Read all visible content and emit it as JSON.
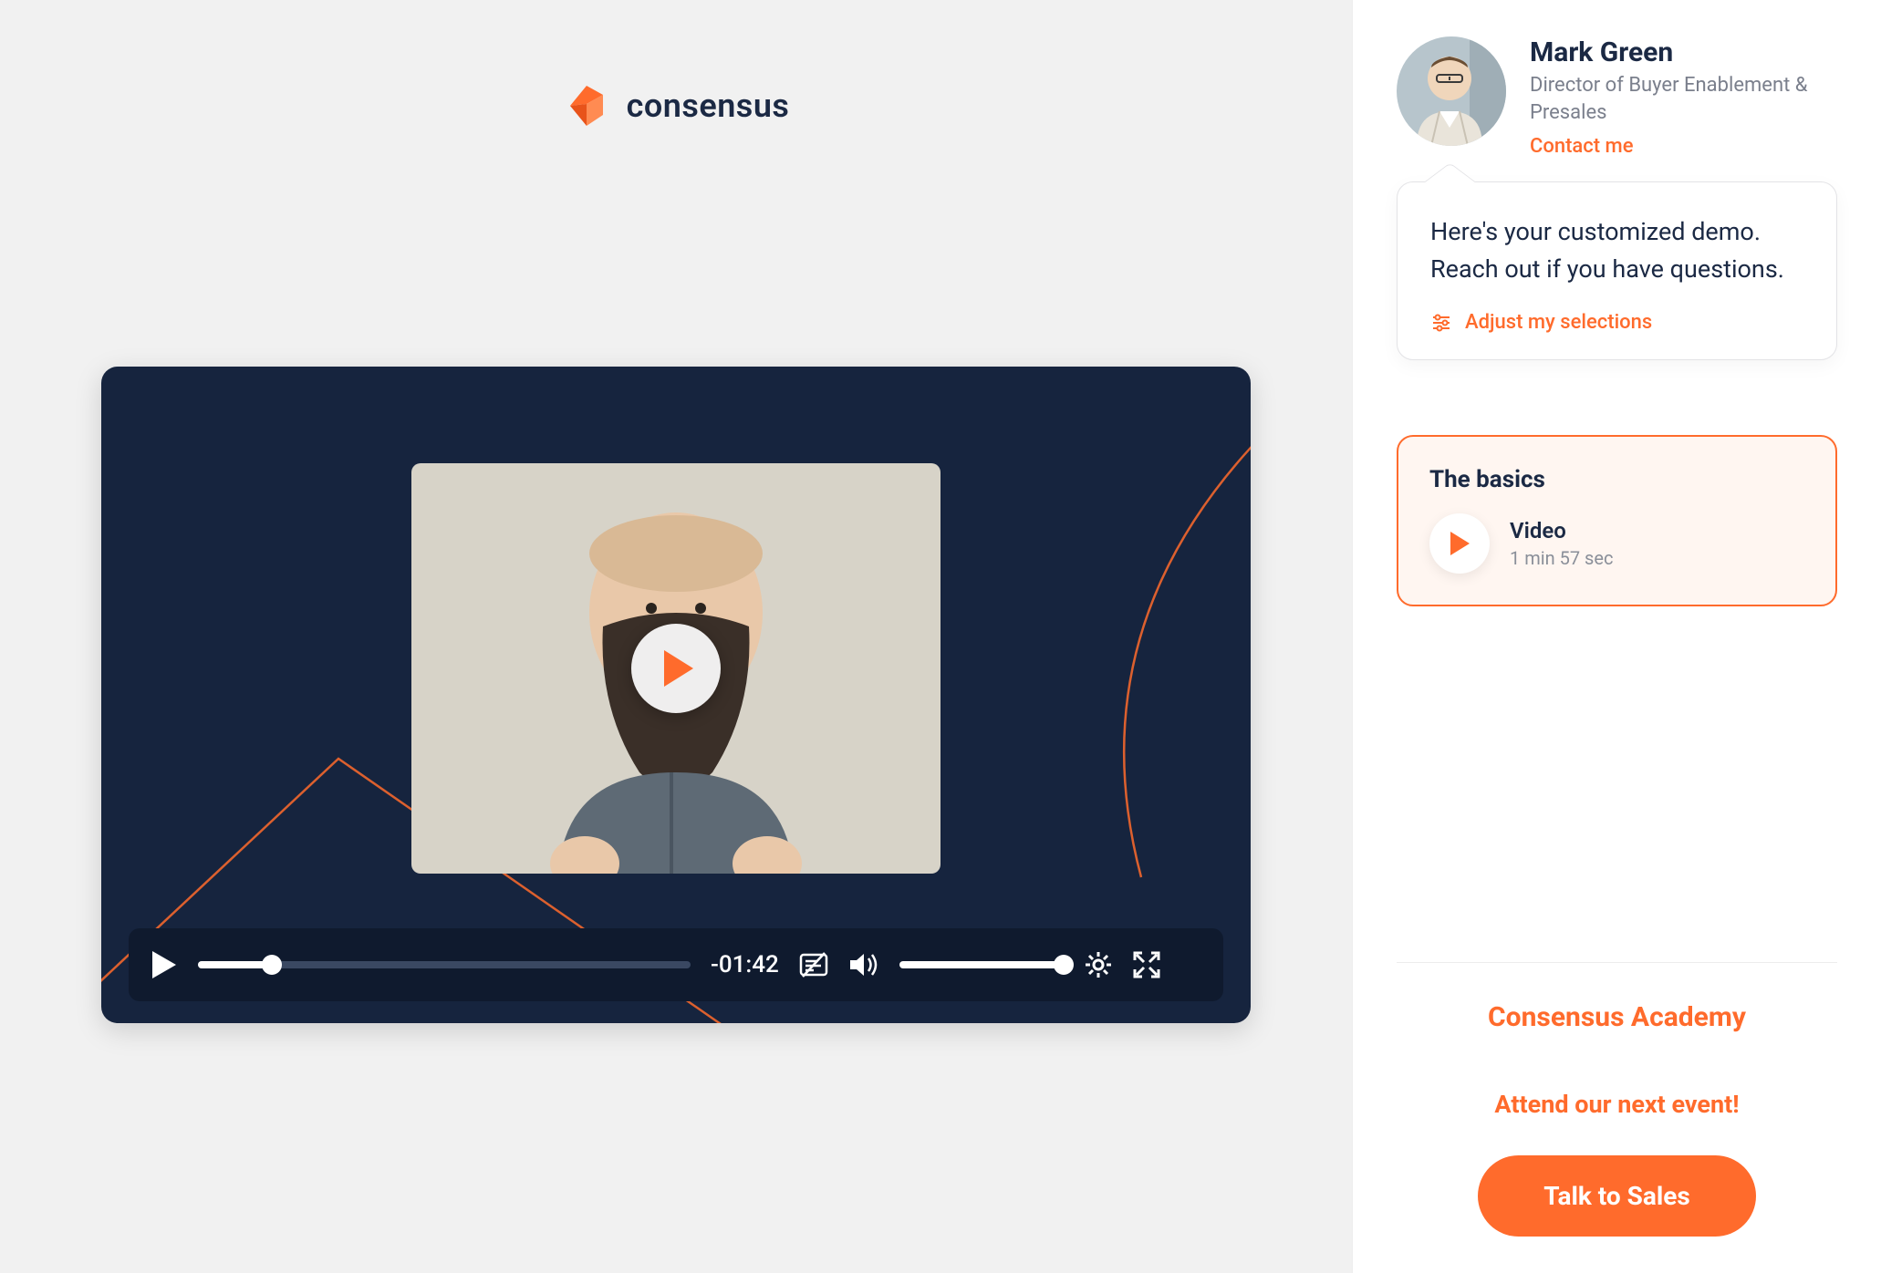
{
  "brand": {
    "name": "consensus"
  },
  "video": {
    "time_remaining": "-01:42",
    "progress_pct": 15,
    "volume_pct": 100
  },
  "contact": {
    "name": "Mark Green",
    "role": "Director of Buyer Enablement & Presales",
    "link_label": "Contact me"
  },
  "bubble": {
    "text": "Here's your customized demo. Reach out if you have questions.",
    "adjust_label": "Adjust my selections"
  },
  "module": {
    "title": "The basics",
    "item_kind": "Video",
    "item_duration": "1 min 57 sec"
  },
  "footer": {
    "academy": "Consensus Academy",
    "event": "Attend our next event!",
    "cta": "Talk to Sales"
  }
}
